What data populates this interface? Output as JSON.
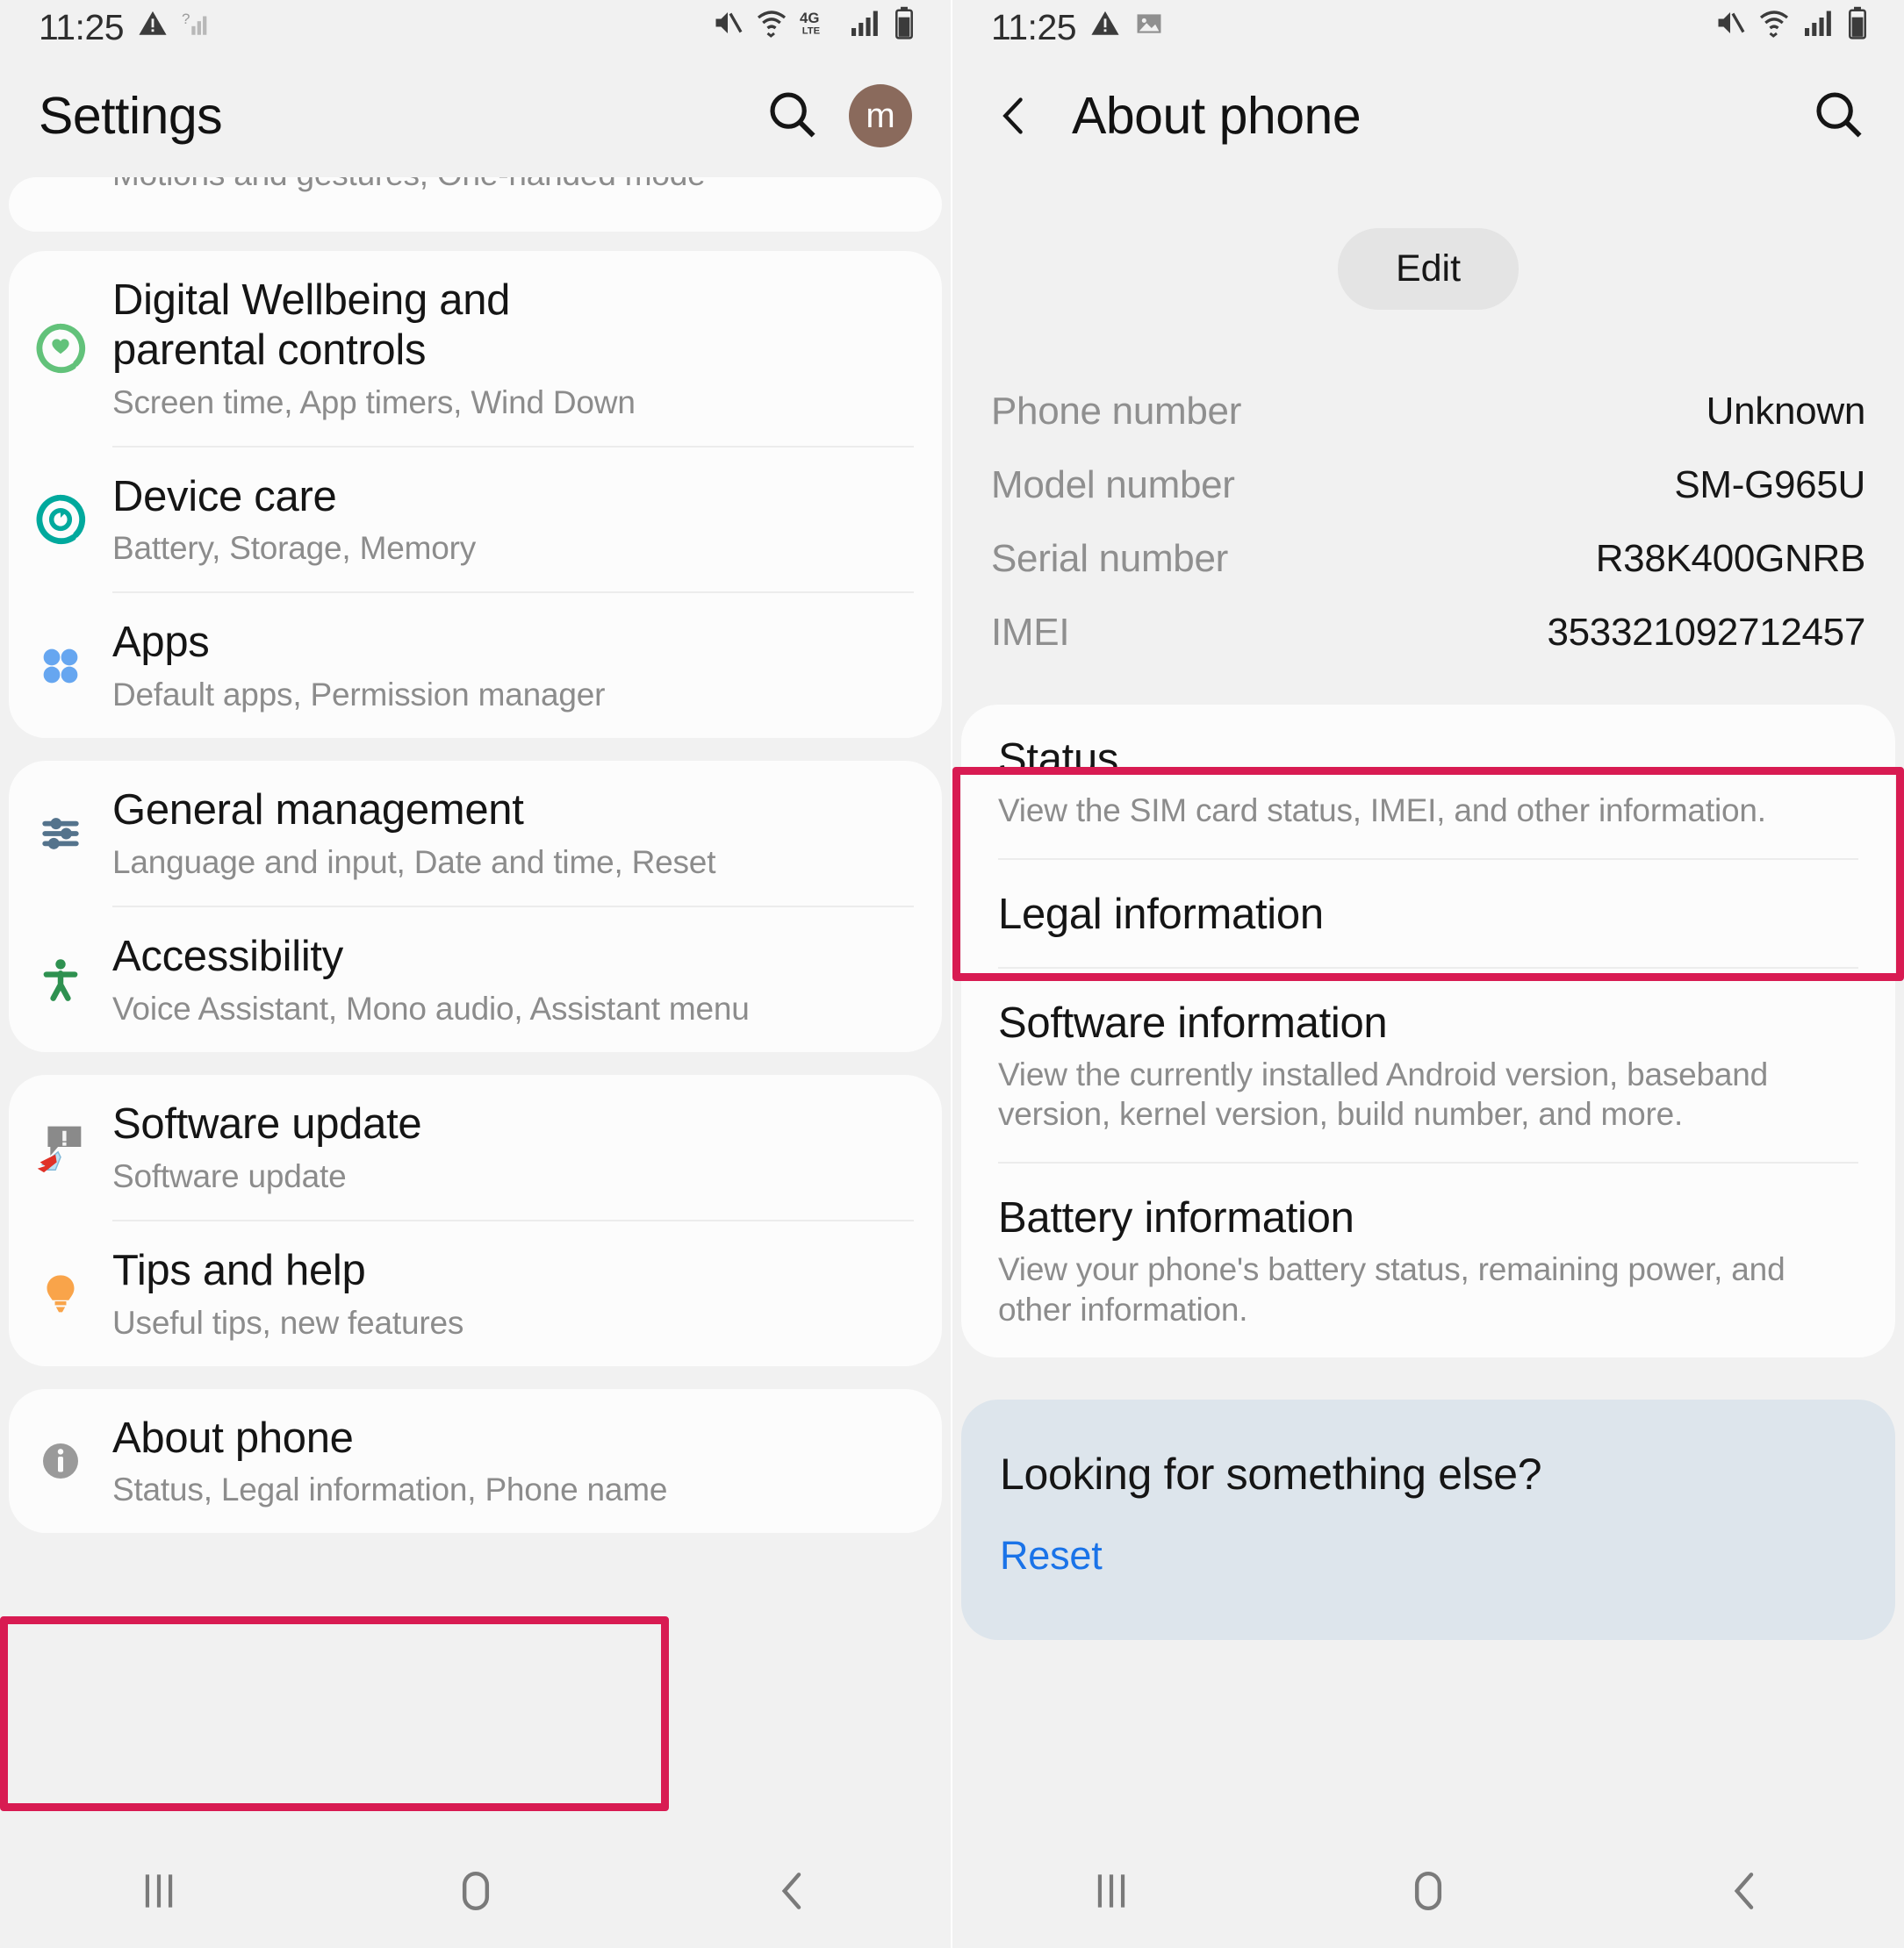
{
  "left": {
    "statusbar": {
      "time": "11:25",
      "icons_left": [
        "warning-triangle-icon",
        "no-sim-signal-icon"
      ],
      "icons_right": [
        "mute-icon",
        "wifi-icon",
        "4g-lte-icon",
        "signal-bars-icon",
        "battery-icon"
      ],
      "network_label": "4G",
      "network_sub": "LTE"
    },
    "header": {
      "title": "Settings",
      "search_icon": "search-icon",
      "avatar_letter": "m"
    },
    "partial_card": {
      "sub": "Motions and gestures, One-handed mode"
    },
    "groups": [
      {
        "items": [
          {
            "icon": "digital-wellbeing-icon",
            "title": "Digital Wellbeing and parental controls",
            "sub": "Screen time, App timers, Wind Down"
          },
          {
            "icon": "device-care-icon",
            "title": "Device care",
            "sub": "Battery, Storage, Memory"
          },
          {
            "icon": "apps-icon",
            "title": "Apps",
            "sub": "Default apps, Permission manager"
          }
        ]
      },
      {
        "items": [
          {
            "icon": "sliders-icon",
            "title": "General management",
            "sub": "Language and input, Date and time, Reset"
          },
          {
            "icon": "accessibility-person-icon",
            "title": "Accessibility",
            "sub": "Voice Assistant, Mono audio, Assistant menu"
          }
        ]
      },
      {
        "items": [
          {
            "icon": "software-update-icon",
            "title": "Software update",
            "sub": "Software update"
          },
          {
            "icon": "lightbulb-icon",
            "title": "Tips and help",
            "sub": "Useful tips, new features"
          }
        ]
      },
      {
        "highlighted": true,
        "items": [
          {
            "icon": "info-circle-icon",
            "title": "About phone",
            "sub": "Status, Legal information, Phone name"
          }
        ]
      }
    ],
    "navbar": [
      "recents-icon",
      "home-icon",
      "back-icon"
    ]
  },
  "right": {
    "statusbar": {
      "time": "11:25",
      "icons_left": [
        "warning-triangle-icon",
        "image-icon"
      ],
      "icons_right": [
        "mute-icon",
        "wifi-icon",
        "signal-bars-icon",
        "battery-icon"
      ]
    },
    "header": {
      "back_icon": "back-chevron-icon",
      "title": "About phone",
      "search_icon": "search-icon"
    },
    "edit_label": "Edit",
    "details": [
      {
        "key": "Phone number",
        "value": "Unknown"
      },
      {
        "key": "Model number",
        "value": "SM-G965U"
      },
      {
        "key": "Serial number",
        "value": "R38K400GNRB"
      },
      {
        "key": "IMEI",
        "value": "353321092712457"
      }
    ],
    "items": [
      {
        "title": "Status",
        "sub": "View the SIM card status, IMEI, and other information.",
        "highlighted": true
      },
      {
        "title": "Legal information",
        "sub": ""
      },
      {
        "title": "Software information",
        "sub": "View the currently installed Android version, baseband version, kernel version, build number, and more."
      },
      {
        "title": "Battery information",
        "sub": "View your phone's battery status, remaining power, and other information."
      }
    ],
    "looking": {
      "title": "Looking for something else?",
      "link": "Reset"
    },
    "navbar": [
      "recents-icon",
      "home-icon",
      "back-icon"
    ]
  },
  "colors": {
    "highlight": "#d81b52",
    "link": "#1a73e8",
    "card": "#fcfcfc",
    "background": "#f1f1f1",
    "looking_card": "#dde5ec"
  }
}
